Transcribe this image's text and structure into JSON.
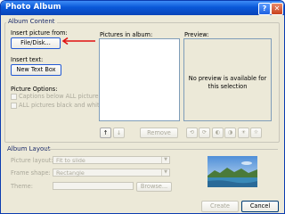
{
  "window": {
    "title": "Photo Album",
    "help_icon": "question-icon",
    "close_icon": "close-icon"
  },
  "album_content": {
    "group_label": "Album Content",
    "insert_picture_from": "Insert picture from:",
    "file_disk_button": "File/Disk...",
    "insert_text": "Insert text:",
    "new_text_box_button": "New Text Box",
    "picture_options": "Picture Options:",
    "captions_option": "Captions below ALL pictures",
    "black_white_option": "ALL pictures black and white",
    "pictures_in_album": "Pictures in album:",
    "preview_label": "Preview:",
    "no_preview_text": "No preview is available for this selection",
    "move_up_label": "↑",
    "move_down_label": "↓",
    "remove_button": "Remove"
  },
  "album_layout": {
    "group_label": "Album Layout",
    "picture_layout_label": "Picture layout:",
    "picture_layout_value": "Fit to slide",
    "frame_shape_label": "Frame shape:",
    "frame_shape_value": "Rectangle",
    "theme_label": "Theme:",
    "browse_button": "Browse..."
  },
  "footer": {
    "create_button": "Create",
    "cancel_button": "Cancel"
  },
  "colors": {
    "titlebar": "#0a58d8",
    "annotation_arrow": "#e01010"
  }
}
